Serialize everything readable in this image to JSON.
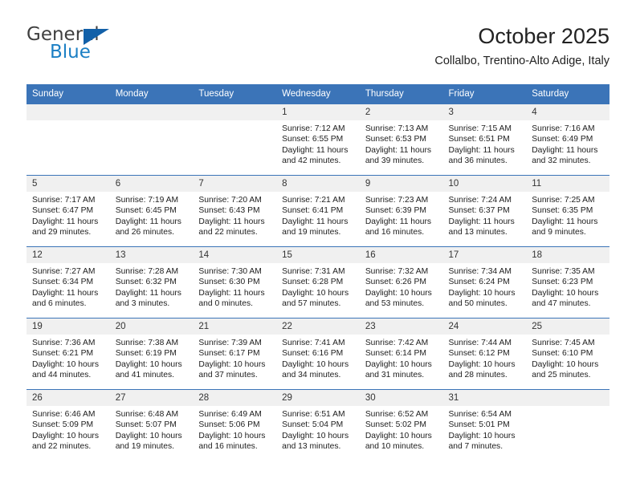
{
  "brand": {
    "name_part1": "General",
    "name_part2": "Blue",
    "triangle_icon": "triangle-icon"
  },
  "header": {
    "title": "October 2025",
    "location": "Collalbo, Trentino-Alto Adige, Italy"
  },
  "calendar": {
    "weekday_headers": [
      "Sunday",
      "Monday",
      "Tuesday",
      "Wednesday",
      "Thursday",
      "Friday",
      "Saturday"
    ],
    "accent_color": "#3b74b8",
    "daynum_bg": "#f0f0f0",
    "weeks": [
      [
        {
          "day": "",
          "lines": []
        },
        {
          "day": "",
          "lines": []
        },
        {
          "day": "",
          "lines": []
        },
        {
          "day": "1",
          "lines": [
            "Sunrise: 7:12 AM",
            "Sunset: 6:55 PM",
            "Daylight: 11 hours",
            "and 42 minutes."
          ]
        },
        {
          "day": "2",
          "lines": [
            "Sunrise: 7:13 AM",
            "Sunset: 6:53 PM",
            "Daylight: 11 hours",
            "and 39 minutes."
          ]
        },
        {
          "day": "3",
          "lines": [
            "Sunrise: 7:15 AM",
            "Sunset: 6:51 PM",
            "Daylight: 11 hours",
            "and 36 minutes."
          ]
        },
        {
          "day": "4",
          "lines": [
            "Sunrise: 7:16 AM",
            "Sunset: 6:49 PM",
            "Daylight: 11 hours",
            "and 32 minutes."
          ]
        }
      ],
      [
        {
          "day": "5",
          "lines": [
            "Sunrise: 7:17 AM",
            "Sunset: 6:47 PM",
            "Daylight: 11 hours",
            "and 29 minutes."
          ]
        },
        {
          "day": "6",
          "lines": [
            "Sunrise: 7:19 AM",
            "Sunset: 6:45 PM",
            "Daylight: 11 hours",
            "and 26 minutes."
          ]
        },
        {
          "day": "7",
          "lines": [
            "Sunrise: 7:20 AM",
            "Sunset: 6:43 PM",
            "Daylight: 11 hours",
            "and 22 minutes."
          ]
        },
        {
          "day": "8",
          "lines": [
            "Sunrise: 7:21 AM",
            "Sunset: 6:41 PM",
            "Daylight: 11 hours",
            "and 19 minutes."
          ]
        },
        {
          "day": "9",
          "lines": [
            "Sunrise: 7:23 AM",
            "Sunset: 6:39 PM",
            "Daylight: 11 hours",
            "and 16 minutes."
          ]
        },
        {
          "day": "10",
          "lines": [
            "Sunrise: 7:24 AM",
            "Sunset: 6:37 PM",
            "Daylight: 11 hours",
            "and 13 minutes."
          ]
        },
        {
          "day": "11",
          "lines": [
            "Sunrise: 7:25 AM",
            "Sunset: 6:35 PM",
            "Daylight: 11 hours",
            "and 9 minutes."
          ]
        }
      ],
      [
        {
          "day": "12",
          "lines": [
            "Sunrise: 7:27 AM",
            "Sunset: 6:34 PM",
            "Daylight: 11 hours",
            "and 6 minutes."
          ]
        },
        {
          "day": "13",
          "lines": [
            "Sunrise: 7:28 AM",
            "Sunset: 6:32 PM",
            "Daylight: 11 hours",
            "and 3 minutes."
          ]
        },
        {
          "day": "14",
          "lines": [
            "Sunrise: 7:30 AM",
            "Sunset: 6:30 PM",
            "Daylight: 11 hours",
            "and 0 minutes."
          ]
        },
        {
          "day": "15",
          "lines": [
            "Sunrise: 7:31 AM",
            "Sunset: 6:28 PM",
            "Daylight: 10 hours",
            "and 57 minutes."
          ]
        },
        {
          "day": "16",
          "lines": [
            "Sunrise: 7:32 AM",
            "Sunset: 6:26 PM",
            "Daylight: 10 hours",
            "and 53 minutes."
          ]
        },
        {
          "day": "17",
          "lines": [
            "Sunrise: 7:34 AM",
            "Sunset: 6:24 PM",
            "Daylight: 10 hours",
            "and 50 minutes."
          ]
        },
        {
          "day": "18",
          "lines": [
            "Sunrise: 7:35 AM",
            "Sunset: 6:23 PM",
            "Daylight: 10 hours",
            "and 47 minutes."
          ]
        }
      ],
      [
        {
          "day": "19",
          "lines": [
            "Sunrise: 7:36 AM",
            "Sunset: 6:21 PM",
            "Daylight: 10 hours",
            "and 44 minutes."
          ]
        },
        {
          "day": "20",
          "lines": [
            "Sunrise: 7:38 AM",
            "Sunset: 6:19 PM",
            "Daylight: 10 hours",
            "and 41 minutes."
          ]
        },
        {
          "day": "21",
          "lines": [
            "Sunrise: 7:39 AM",
            "Sunset: 6:17 PM",
            "Daylight: 10 hours",
            "and 37 minutes."
          ]
        },
        {
          "day": "22",
          "lines": [
            "Sunrise: 7:41 AM",
            "Sunset: 6:16 PM",
            "Daylight: 10 hours",
            "and 34 minutes."
          ]
        },
        {
          "day": "23",
          "lines": [
            "Sunrise: 7:42 AM",
            "Sunset: 6:14 PM",
            "Daylight: 10 hours",
            "and 31 minutes."
          ]
        },
        {
          "day": "24",
          "lines": [
            "Sunrise: 7:44 AM",
            "Sunset: 6:12 PM",
            "Daylight: 10 hours",
            "and 28 minutes."
          ]
        },
        {
          "day": "25",
          "lines": [
            "Sunrise: 7:45 AM",
            "Sunset: 6:10 PM",
            "Daylight: 10 hours",
            "and 25 minutes."
          ]
        }
      ],
      [
        {
          "day": "26",
          "lines": [
            "Sunrise: 6:46 AM",
            "Sunset: 5:09 PM",
            "Daylight: 10 hours",
            "and 22 minutes."
          ]
        },
        {
          "day": "27",
          "lines": [
            "Sunrise: 6:48 AM",
            "Sunset: 5:07 PM",
            "Daylight: 10 hours",
            "and 19 minutes."
          ]
        },
        {
          "day": "28",
          "lines": [
            "Sunrise: 6:49 AM",
            "Sunset: 5:06 PM",
            "Daylight: 10 hours",
            "and 16 minutes."
          ]
        },
        {
          "day": "29",
          "lines": [
            "Sunrise: 6:51 AM",
            "Sunset: 5:04 PM",
            "Daylight: 10 hours",
            "and 13 minutes."
          ]
        },
        {
          "day": "30",
          "lines": [
            "Sunrise: 6:52 AM",
            "Sunset: 5:02 PM",
            "Daylight: 10 hours",
            "and 10 minutes."
          ]
        },
        {
          "day": "31",
          "lines": [
            "Sunrise: 6:54 AM",
            "Sunset: 5:01 PM",
            "Daylight: 10 hours",
            "and 7 minutes."
          ]
        },
        {
          "day": "",
          "lines": []
        }
      ]
    ]
  }
}
